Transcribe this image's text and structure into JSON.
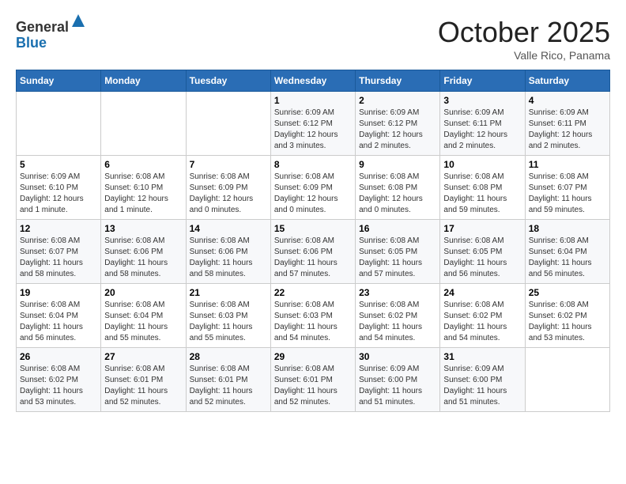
{
  "header": {
    "logo_line1": "General",
    "logo_line2": "Blue",
    "month": "October 2025",
    "location": "Valle Rico, Panama"
  },
  "days_of_week": [
    "Sunday",
    "Monday",
    "Tuesday",
    "Wednesday",
    "Thursday",
    "Friday",
    "Saturday"
  ],
  "weeks": [
    [
      {
        "day": "",
        "info": ""
      },
      {
        "day": "",
        "info": ""
      },
      {
        "day": "",
        "info": ""
      },
      {
        "day": "1",
        "info": "Sunrise: 6:09 AM\nSunset: 6:12 PM\nDaylight: 12 hours and 3 minutes."
      },
      {
        "day": "2",
        "info": "Sunrise: 6:09 AM\nSunset: 6:12 PM\nDaylight: 12 hours and 2 minutes."
      },
      {
        "day": "3",
        "info": "Sunrise: 6:09 AM\nSunset: 6:11 PM\nDaylight: 12 hours and 2 minutes."
      },
      {
        "day": "4",
        "info": "Sunrise: 6:09 AM\nSunset: 6:11 PM\nDaylight: 12 hours and 2 minutes."
      }
    ],
    [
      {
        "day": "5",
        "info": "Sunrise: 6:09 AM\nSunset: 6:10 PM\nDaylight: 12 hours and 1 minute."
      },
      {
        "day": "6",
        "info": "Sunrise: 6:08 AM\nSunset: 6:10 PM\nDaylight: 12 hours and 1 minute."
      },
      {
        "day": "7",
        "info": "Sunrise: 6:08 AM\nSunset: 6:09 PM\nDaylight: 12 hours and 0 minutes."
      },
      {
        "day": "8",
        "info": "Sunrise: 6:08 AM\nSunset: 6:09 PM\nDaylight: 12 hours and 0 minutes."
      },
      {
        "day": "9",
        "info": "Sunrise: 6:08 AM\nSunset: 6:08 PM\nDaylight: 12 hours and 0 minutes."
      },
      {
        "day": "10",
        "info": "Sunrise: 6:08 AM\nSunset: 6:08 PM\nDaylight: 11 hours and 59 minutes."
      },
      {
        "day": "11",
        "info": "Sunrise: 6:08 AM\nSunset: 6:07 PM\nDaylight: 11 hours and 59 minutes."
      }
    ],
    [
      {
        "day": "12",
        "info": "Sunrise: 6:08 AM\nSunset: 6:07 PM\nDaylight: 11 hours and 58 minutes."
      },
      {
        "day": "13",
        "info": "Sunrise: 6:08 AM\nSunset: 6:06 PM\nDaylight: 11 hours and 58 minutes."
      },
      {
        "day": "14",
        "info": "Sunrise: 6:08 AM\nSunset: 6:06 PM\nDaylight: 11 hours and 58 minutes."
      },
      {
        "day": "15",
        "info": "Sunrise: 6:08 AM\nSunset: 6:06 PM\nDaylight: 11 hours and 57 minutes."
      },
      {
        "day": "16",
        "info": "Sunrise: 6:08 AM\nSunset: 6:05 PM\nDaylight: 11 hours and 57 minutes."
      },
      {
        "day": "17",
        "info": "Sunrise: 6:08 AM\nSunset: 6:05 PM\nDaylight: 11 hours and 56 minutes."
      },
      {
        "day": "18",
        "info": "Sunrise: 6:08 AM\nSunset: 6:04 PM\nDaylight: 11 hours and 56 minutes."
      }
    ],
    [
      {
        "day": "19",
        "info": "Sunrise: 6:08 AM\nSunset: 6:04 PM\nDaylight: 11 hours and 56 minutes."
      },
      {
        "day": "20",
        "info": "Sunrise: 6:08 AM\nSunset: 6:04 PM\nDaylight: 11 hours and 55 minutes."
      },
      {
        "day": "21",
        "info": "Sunrise: 6:08 AM\nSunset: 6:03 PM\nDaylight: 11 hours and 55 minutes."
      },
      {
        "day": "22",
        "info": "Sunrise: 6:08 AM\nSunset: 6:03 PM\nDaylight: 11 hours and 54 minutes."
      },
      {
        "day": "23",
        "info": "Sunrise: 6:08 AM\nSunset: 6:02 PM\nDaylight: 11 hours and 54 minutes."
      },
      {
        "day": "24",
        "info": "Sunrise: 6:08 AM\nSunset: 6:02 PM\nDaylight: 11 hours and 54 minutes."
      },
      {
        "day": "25",
        "info": "Sunrise: 6:08 AM\nSunset: 6:02 PM\nDaylight: 11 hours and 53 minutes."
      }
    ],
    [
      {
        "day": "26",
        "info": "Sunrise: 6:08 AM\nSunset: 6:02 PM\nDaylight: 11 hours and 53 minutes."
      },
      {
        "day": "27",
        "info": "Sunrise: 6:08 AM\nSunset: 6:01 PM\nDaylight: 11 hours and 52 minutes."
      },
      {
        "day": "28",
        "info": "Sunrise: 6:08 AM\nSunset: 6:01 PM\nDaylight: 11 hours and 52 minutes."
      },
      {
        "day": "29",
        "info": "Sunrise: 6:08 AM\nSunset: 6:01 PM\nDaylight: 11 hours and 52 minutes."
      },
      {
        "day": "30",
        "info": "Sunrise: 6:09 AM\nSunset: 6:00 PM\nDaylight: 11 hours and 51 minutes."
      },
      {
        "day": "31",
        "info": "Sunrise: 6:09 AM\nSunset: 6:00 PM\nDaylight: 11 hours and 51 minutes."
      },
      {
        "day": "",
        "info": ""
      }
    ]
  ]
}
